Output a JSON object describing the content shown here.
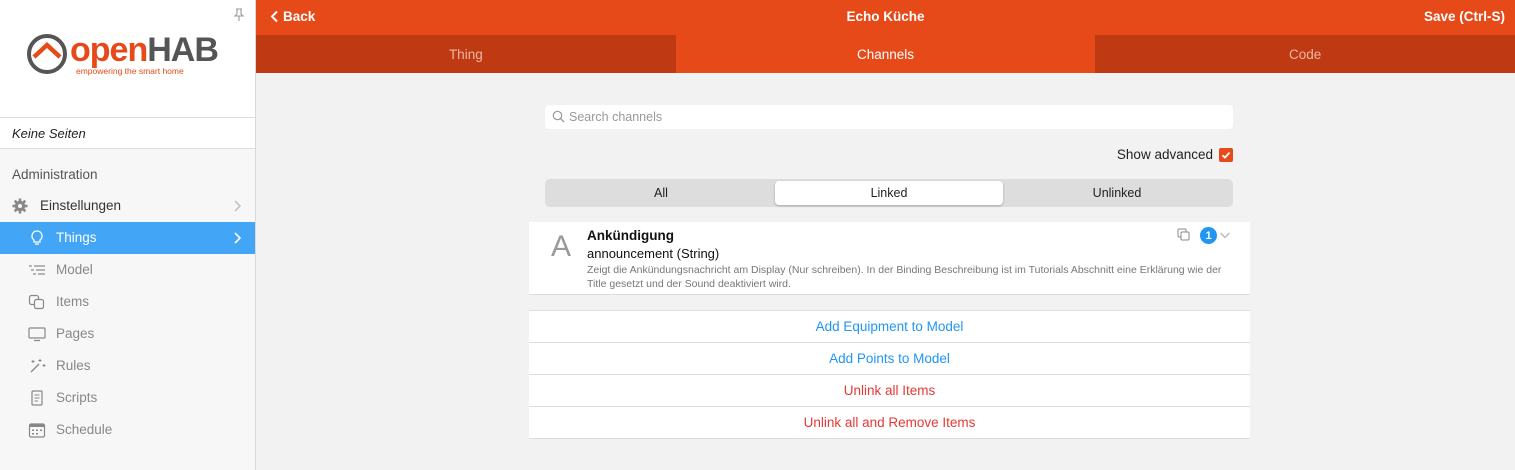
{
  "sidebar": {
    "logo": {
      "word_open": "open",
      "word_hab": "HAB",
      "tagline": "empowering the smart home"
    },
    "pages_placeholder": "Keine Seiten",
    "section_title": "Administration",
    "settings_label": "Einstellungen",
    "items": [
      {
        "label": "Things",
        "icon": "lightbulb-icon"
      },
      {
        "label": "Model",
        "icon": "list-tree-icon"
      },
      {
        "label": "Items",
        "icon": "squares-icon"
      },
      {
        "label": "Pages",
        "icon": "monitor-icon"
      },
      {
        "label": "Rules",
        "icon": "magic-wand-icon"
      },
      {
        "label": "Scripts",
        "icon": "document-icon"
      },
      {
        "label": "Schedule",
        "icon": "calendar-icon"
      }
    ]
  },
  "header": {
    "back_label": "Back",
    "title": "Echo Küche",
    "save_label": "Save (Ctrl-S)"
  },
  "tabs": [
    {
      "label": "Thing"
    },
    {
      "label": "Channels"
    },
    {
      "label": "Code"
    }
  ],
  "search": {
    "placeholder": "Search channels"
  },
  "advanced": {
    "label": "Show advanced",
    "checked": true
  },
  "filter": [
    {
      "label": "All"
    },
    {
      "label": "Linked"
    },
    {
      "label": "Unlinked"
    }
  ],
  "channel": {
    "type_letter": "A",
    "label": "Ankündigung",
    "id_type": "announcement (String)",
    "description": "Zeigt die Ankündungsnachricht am Display (Nur schreiben). In der Binding Beschreibung ist im Tutorials Abschnitt eine Erklärung wie der Title gesetzt und der Sound deaktiviert wird.",
    "link_count": "1"
  },
  "actions": {
    "add_equipment": "Add Equipment to Model",
    "add_points": "Add Points to Model",
    "unlink_all": "Unlink all Items",
    "unlink_remove": "Unlink all and Remove Items"
  },
  "colors": {
    "brand": "#e64a19",
    "tab_bar": "#bf3a13",
    "active_nav": "#42a5f5",
    "link_blue": "#2196f3",
    "danger_red": "#e53935"
  }
}
